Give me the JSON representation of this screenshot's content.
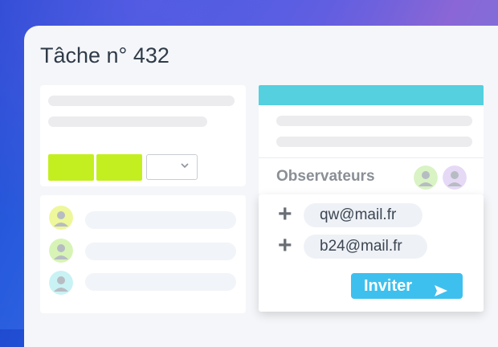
{
  "task": {
    "title": "Tâche n° 432"
  },
  "observers": {
    "label": "Observateurs"
  },
  "invites": [
    {
      "email": "qw@mail.fr"
    },
    {
      "email": "b24@mail.fr"
    }
  ],
  "invite_button": {
    "label": "Inviter",
    "icon": "send-icon"
  },
  "colors": {
    "accent_teal": "#54d0df",
    "accent_green": "#c3ef20",
    "button_blue": "#3ec0ee"
  }
}
